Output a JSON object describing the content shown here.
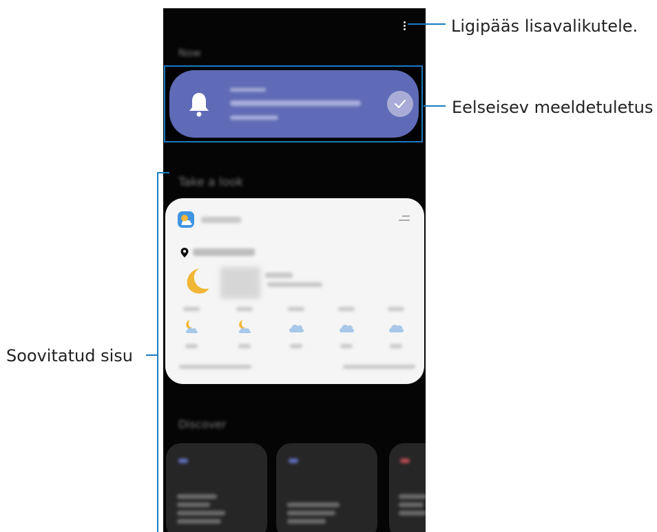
{
  "annotations": {
    "more_options": "Ligipääs lisavalikutele.",
    "previous_reminder": "Eelseisev meeldetuletus",
    "suggested_content": "Soovitatud sisu"
  },
  "screen": {
    "section_now": "Now",
    "section_take_a_look": "Take a look",
    "section_discover": "Discover",
    "reminder": {
      "label": "Upcoming",
      "title": "Buy milk on the way home",
      "time": "Today, 19:00"
    },
    "weather": {
      "title": "Weather",
      "location": "Samsung-dong",
      "temperature": "16°",
      "condition": "Clear",
      "detail": "Updated 19:00",
      "forecast": [
        {
          "time": "20:00",
          "icon": "moon-cloud-icon",
          "temp": "15°"
        },
        {
          "time": "21:00",
          "icon": "moon-cloud-icon",
          "temp": "15°"
        },
        {
          "time": "22:00",
          "icon": "cloud-icon",
          "temp": "15°"
        },
        {
          "time": "23:00",
          "icon": "cloud-icon",
          "temp": "14°"
        },
        {
          "time": "00:00",
          "icon": "cloud-icon",
          "temp": "13°"
        }
      ],
      "footer_left": "The Weather Channel",
      "footer_right": "Updated 19:00 today"
    },
    "colors": {
      "reminder_card": "#5f6bb6",
      "annotation_line": "#1a7bbf",
      "weather_card": "#f5f5f5"
    }
  }
}
